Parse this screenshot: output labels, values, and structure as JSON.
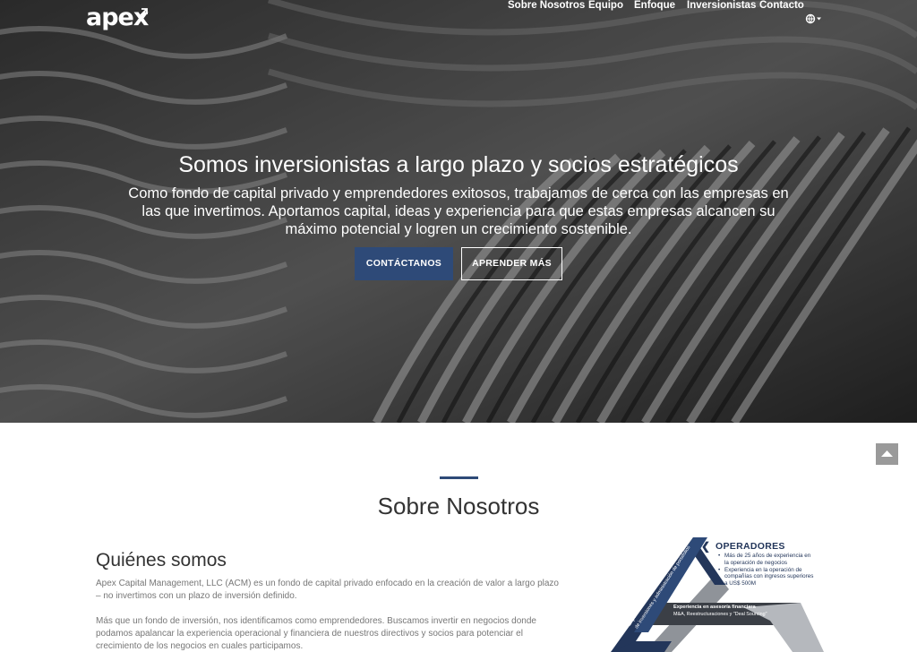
{
  "brand": {
    "logo": "apex"
  },
  "nav": {
    "items": [
      {
        "label": "Sobre Nosotros"
      },
      {
        "label": "Equipo"
      },
      {
        "label": "Enfoque"
      },
      {
        "label": "Inversionistas"
      },
      {
        "label": "Contacto"
      }
    ],
    "language_icon": "globe-icon"
  },
  "hero": {
    "title": "Somos inversionistas a largo plazo y socios estratégicos",
    "text": "Como fondo de capital privado y emprendedores exitosos, trabajamos de cerca con las empresas en las que invertimos. Aportamos capital, ideas y experiencia para que estas empresas alcancen su máximo potencial y logren un crecimiento sostenible.",
    "primary_button": "CONTÁCTANOS",
    "secondary_button": "APRENDER MÁS"
  },
  "about": {
    "section_title": "Sobre Nosotros",
    "subtitle": "Quiénes somos",
    "paragraph_1": "Apex Capital Management, LLC (ACM) es un fondo de capital privado enfocado en la creación de valor a largo plazo – no invertimos con un plazo de inversión definido.",
    "paragraph_2": "Más que un fondo de inversión, nos identificamos como emprendedores. Buscamos invertir en negocios donde podamos apalancar la experiencia operacional y financiera de nuestros directivos y socios para potenciar el crecimiento de los negocios en cuales participamos."
  },
  "diagram": {
    "title": "OPERADORES",
    "bullets": [
      "Más de 25 años de experiencia en la operación de negocios",
      "Experiencia en la operación de compañías con ingresos superiores a US$ 500M"
    ],
    "bar_title": "Experiencia en asesoría financiera",
    "bar_subtitle": "M&A, Reestructuraciones y \"Deal Sourcing\"",
    "side_title": "Experiencia como gestor",
    "side_subtitle": "de inversiones y administración de portafolios"
  },
  "colors": {
    "accent": "#2e4a78",
    "navy": "#23365a",
    "gray_triangle": "#8f9399"
  },
  "scroll_top_icon": "arrow-up-icon"
}
